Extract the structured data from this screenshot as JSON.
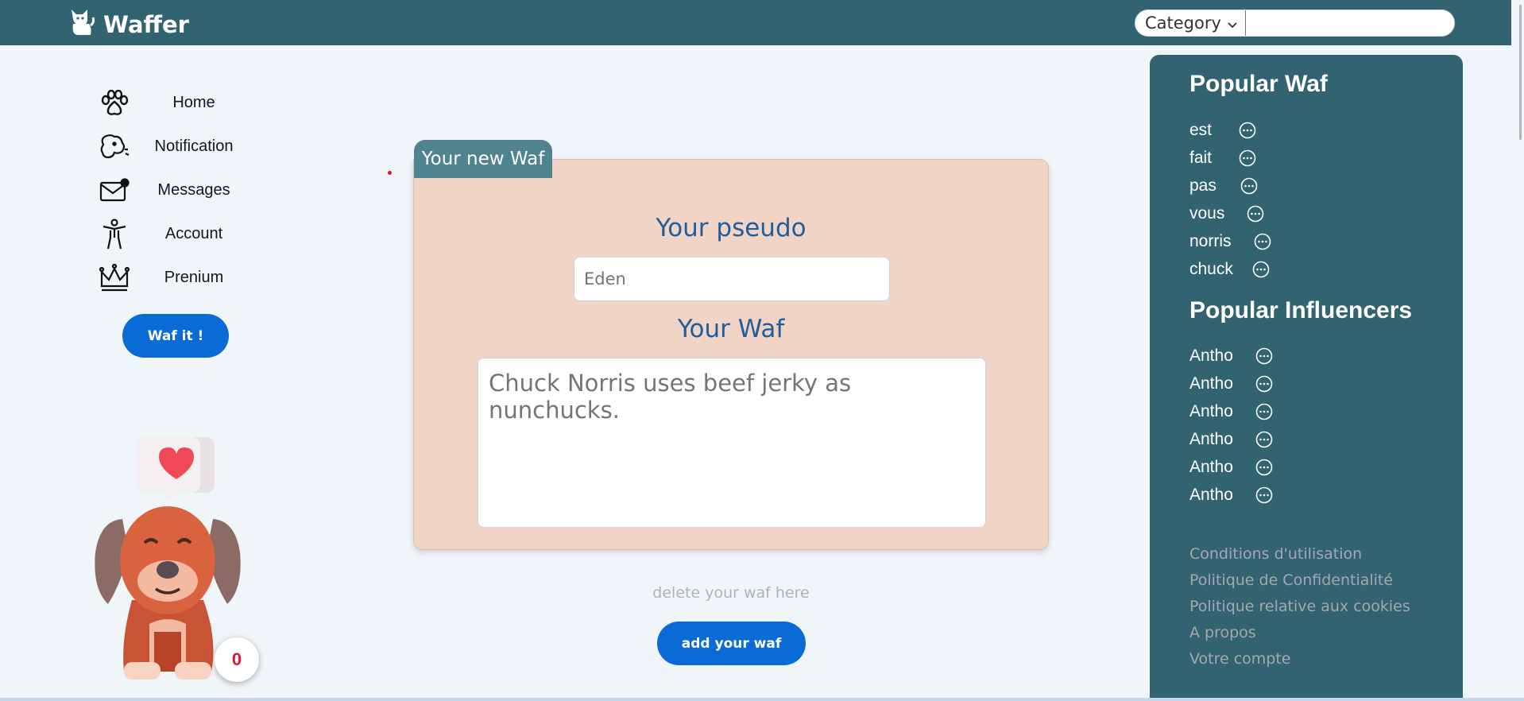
{
  "brand": {
    "name": "Waffer"
  },
  "search": {
    "category_label": "Category",
    "placeholder": ""
  },
  "nav": {
    "items": [
      {
        "label": "Home",
        "icon": "paw-icon"
      },
      {
        "label": "Notification",
        "icon": "dog-head-icon"
      },
      {
        "label": "Messages",
        "icon": "mail-icon"
      },
      {
        "label": "Account",
        "icon": "person-icon"
      },
      {
        "label": "Prenium",
        "icon": "crown-icon"
      }
    ],
    "waf_button": "Waf it !"
  },
  "likes": {
    "count": "0"
  },
  "composer": {
    "tab_label": "Your new Waf",
    "pseudo_title": "Your pseudo",
    "pseudo_placeholder": "Eden",
    "waf_title": "Your Waf",
    "waf_placeholder": "Chuck Norris uses beef jerky as nunchucks.",
    "delete_text": "delete your waf here",
    "add_button": "add your waf"
  },
  "sidebar": {
    "popular_waf_title": "Popular Waf",
    "popular_waf": [
      "est",
      "fait",
      "pas",
      "vous",
      "norris",
      "chuck"
    ],
    "influencers_title": "Popular Influencers",
    "influencers": [
      "Antho",
      "Antho",
      "Antho",
      "Antho",
      "Antho",
      "Antho"
    ],
    "footer_links": [
      "Conditions d'utilisation",
      "Politique de Confidentialité",
      "Politique relative aux cookies",
      "A propos",
      "Votre compte"
    ]
  },
  "colors": {
    "header": "#326370",
    "accent": "#0a6bd6",
    "card": "#f2d4c7",
    "title": "#1f5d9c"
  }
}
